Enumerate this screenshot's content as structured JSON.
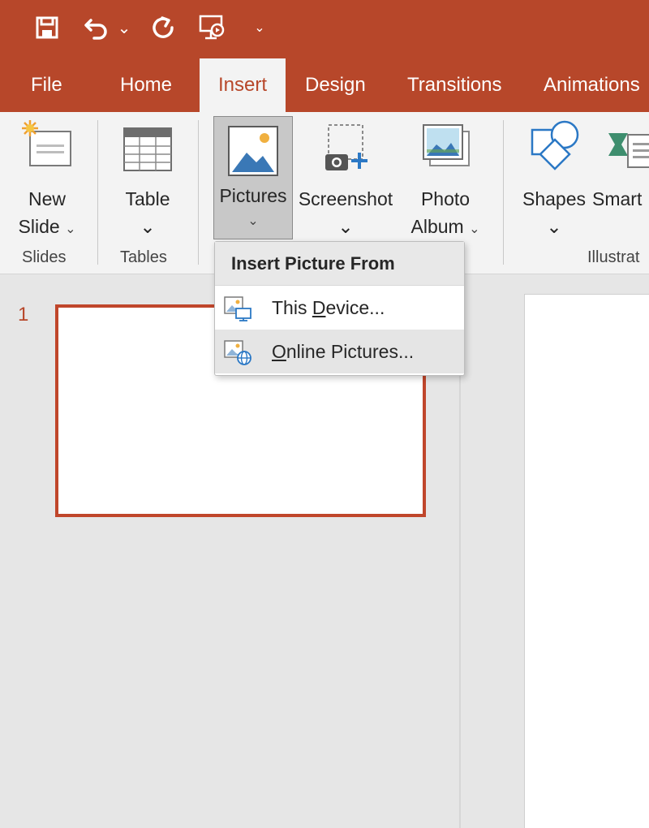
{
  "qat": {
    "save_icon": "save-icon",
    "undo_icon": "undo-icon",
    "undo_dropdown": "⌄",
    "redo_icon": "repeat-icon",
    "present_icon": "start-from-beginning-icon",
    "customize": "⌄"
  },
  "tabs": [
    {
      "label": "File"
    },
    {
      "label": "Home"
    },
    {
      "label": "Insert"
    },
    {
      "label": "Design"
    },
    {
      "label": "Transitions"
    },
    {
      "label": "Animations"
    }
  ],
  "ribbon": {
    "new_slide": {
      "line1": "New",
      "line2": "Slide"
    },
    "table": {
      "label": "Table"
    },
    "pictures": {
      "label": "Pictures"
    },
    "screenshot": {
      "label": "Screenshot"
    },
    "photo_album": {
      "line1": "Photo",
      "line2": "Album"
    },
    "shapes": {
      "label": "Shapes"
    },
    "smartart": {
      "label": "Smart"
    },
    "groups": {
      "slides": "Slides",
      "tables": "Tables",
      "illustrations": "Illustrat"
    },
    "chevron": "⌄"
  },
  "slide_panel": {
    "slide_number": "1"
  },
  "dropdown": {
    "header": "Insert Picture From",
    "items": [
      {
        "access_key": "D",
        "before": "This ",
        "after": "evice..."
      },
      {
        "access_key": "O",
        "before": "",
        "after": "nline Pictures..."
      }
    ]
  },
  "colors": {
    "accent": "#b7472a",
    "ribbon_bg": "#f3f3f3",
    "workspace_bg": "#e6e6e6"
  }
}
